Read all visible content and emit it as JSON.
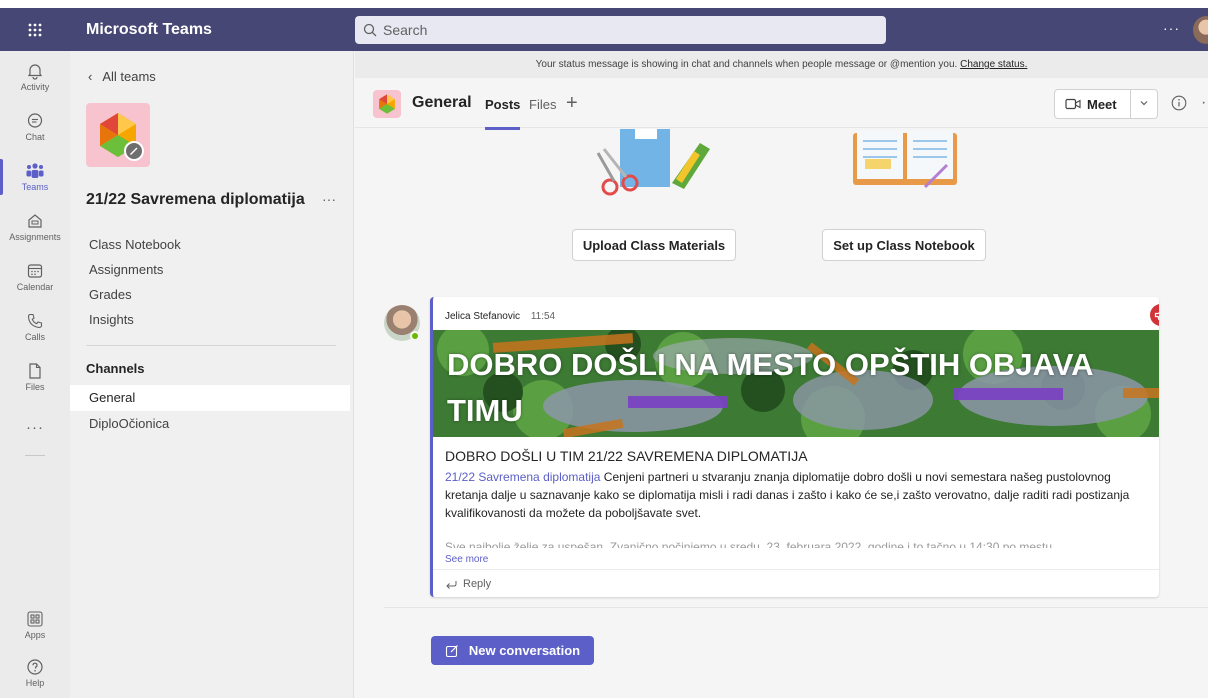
{
  "app": {
    "title": "Microsoft Teams"
  },
  "search": {
    "placeholder": "Search"
  },
  "topbar": {
    "more": "···"
  },
  "rail": {
    "items": [
      {
        "label": "Activity",
        "icon": "bell-icon"
      },
      {
        "label": "Chat",
        "icon": "chat-icon"
      },
      {
        "label": "Teams",
        "icon": "teams-icon",
        "active": true
      },
      {
        "label": "Assignments",
        "icon": "assignments-icon"
      },
      {
        "label": "Calendar",
        "icon": "calendar-icon"
      },
      {
        "label": "Calls",
        "icon": "phone-icon"
      },
      {
        "label": "Files",
        "icon": "file-icon"
      }
    ],
    "more": "···",
    "apps_label": "Apps",
    "help_label": "Help"
  },
  "leftpane": {
    "back_label": "All teams",
    "team_name": "21/22 Savremena diplomatija",
    "team_more": "···",
    "nav": [
      "Class Notebook",
      "Assignments",
      "Grades",
      "Insights"
    ],
    "channels_heading": "Channels",
    "channels": [
      "General",
      "DiploOčionica"
    ]
  },
  "banner": {
    "text": "Your status message is showing in chat and channels when people message or @mention you.",
    "link": "Change status."
  },
  "channel_header": {
    "title": "General",
    "tabs": [
      "Posts",
      "Files"
    ],
    "add": "+",
    "meet_label": "Meet",
    "more": "·"
  },
  "onboarding": {
    "upload_label": "Upload Class Materials",
    "notebook_label": "Set up Class Notebook"
  },
  "post": {
    "author": "Jelica Stefanovic",
    "time": "11:54",
    "hero_title": "DOBRO DOŠLI NA MESTO OPŠTIH OBJAVA TIMU",
    "subject": "DOBRO DOŠLI U TIM 21/22 SAVREMENA DIPLOMATIJA",
    "mention": "21/22 Savremena diplomatija",
    "body": " Cenjeni partneri u stvaranju znanja diplomatije dobro došli u novi semestara našeg pustolovnog kretanja dalje u saznavanje kako se diplomatija misli i radi danas i zašto i kako će se,i zašto verovatno, dalje raditi radi postizanja kvalifikovanosti da možete da poboljšavate svet.",
    "faded": "Sve najbolje želje za uspešan. Zvanično počinjemo u sredu, 23. februara 2022. godine i to tačno u 14:30 po mestu",
    "see_more": "See more",
    "reply_label": "Reply"
  },
  "new_conversation_label": "New conversation",
  "colors": {
    "topbar": "#464775",
    "accent": "#5b5fc7",
    "announcement": "#d13438"
  }
}
